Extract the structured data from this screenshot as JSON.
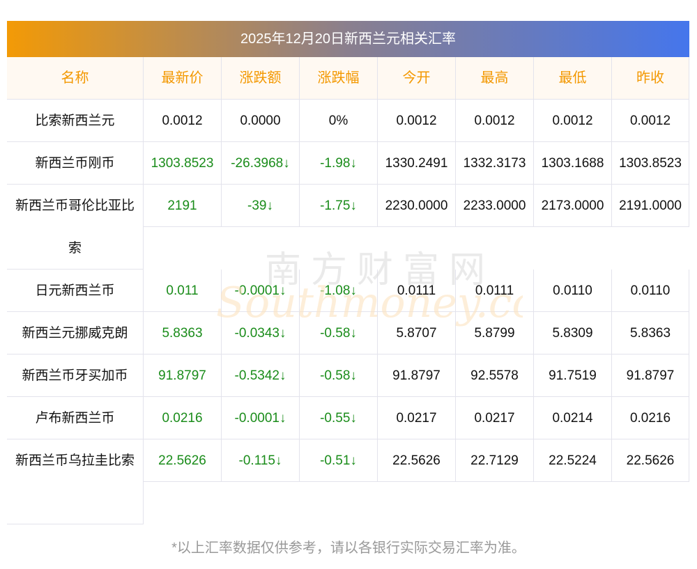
{
  "title": "2025年12月20日新西兰元相关汇率",
  "headers": [
    "名称",
    "最新价",
    "涨跌额",
    "涨跌幅",
    "今开",
    "最高",
    "最低",
    "昨收"
  ],
  "rows": [
    {
      "name": "比索新西兰元",
      "cells": [
        "0.0012",
        "0.0000",
        "0%",
        "0.0012",
        "0.0012",
        "0.0012",
        "0.0012"
      ],
      "up": false
    },
    {
      "name": "新西兰币刚币",
      "cells": [
        "1303.8523",
        "-26.3968↓",
        "-1.98↓",
        "1330.2491",
        "1332.3173",
        "1303.1688",
        "1303.8523"
      ],
      "down": true
    },
    {
      "name": "新西兰币哥伦比亚比索",
      "cells": [
        "2191",
        "-39↓",
        "-1.75↓",
        "2230.0000",
        "2233.0000",
        "2173.0000",
        "2191.0000"
      ],
      "down": true
    },
    {
      "name": "日元新西兰币",
      "cells": [
        "0.011",
        "-0.0001↓",
        "-1.08↓",
        "0.0111",
        "0.0111",
        "0.0110",
        "0.0110"
      ],
      "down": true
    },
    {
      "name": "新西兰元挪威克朗",
      "cells": [
        "5.8363",
        "-0.0343↓",
        "-0.58↓",
        "5.8707",
        "5.8799",
        "5.8309",
        "5.8363"
      ],
      "down": true
    },
    {
      "name": "新西兰币牙买加币",
      "cells": [
        "91.8797",
        "-0.5342↓",
        "-0.58↓",
        "91.8797",
        "92.5578",
        "91.7519",
        "91.8797"
      ],
      "down": true
    },
    {
      "name": "卢布新西兰币",
      "cells": [
        "0.0216",
        "-0.0001↓",
        "-0.55↓",
        "0.0217",
        "0.0217",
        "0.0214",
        "0.0216"
      ],
      "down": true
    },
    {
      "name": "新西兰币乌拉圭比索",
      "cells": [
        "22.5626",
        "-0.115↓",
        "-0.51↓",
        "22.5626",
        "22.7129",
        "22.5224",
        "22.5626"
      ],
      "down": true
    }
  ],
  "watermark": {
    "cn": "南方财富网",
    "en": "Southmoney.com"
  },
  "footer": "*以上汇率数据仅供参考，请以各银行实际交易汇率为准。",
  "colors": {
    "header": "#f39800",
    "down": "#1a8c1a"
  }
}
